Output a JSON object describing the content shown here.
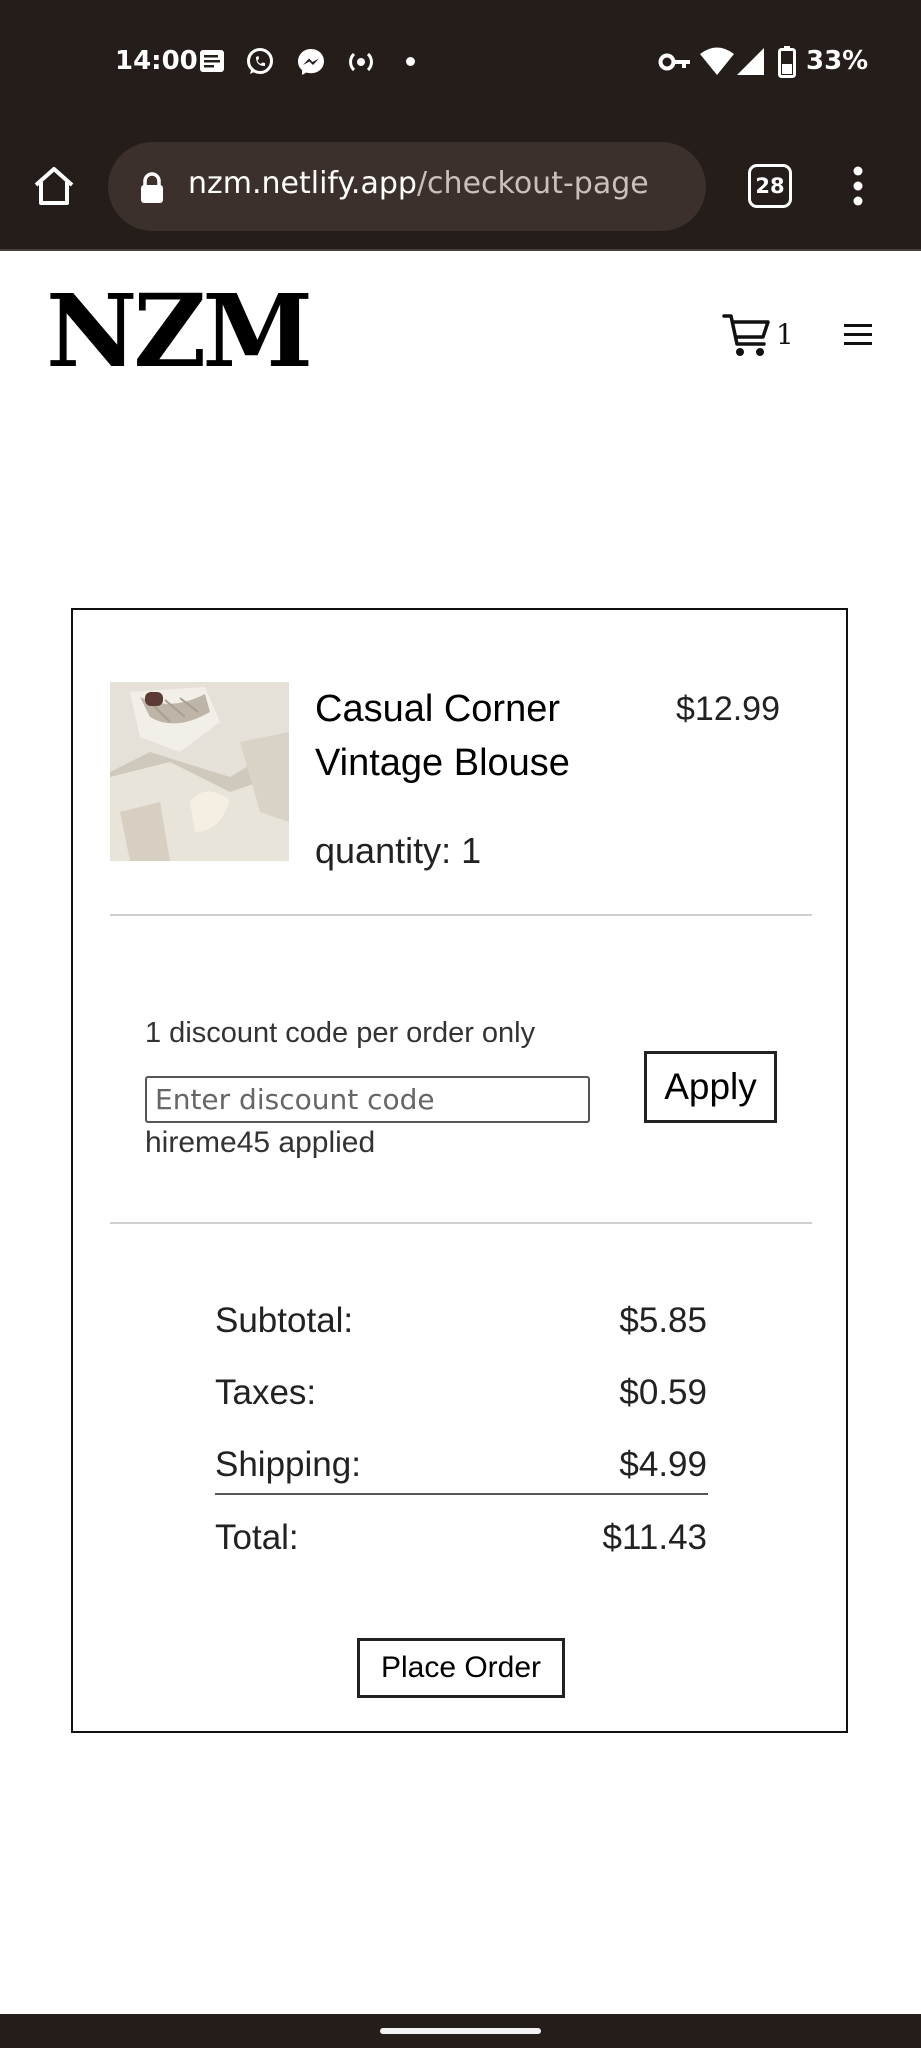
{
  "status_bar": {
    "time": "14:00",
    "battery": "33%",
    "icons": [
      "notes-icon",
      "whatsapp-icon",
      "messenger-icon",
      "hotspot-icon",
      "dot-icon",
      "vpn-key-icon",
      "wifi-icon",
      "signal-icon",
      "battery-icon"
    ]
  },
  "browser": {
    "url_domain": "nzm.netlify.app",
    "url_path": "/checkout-page",
    "tab_count": "28",
    "icons": [
      "home-icon",
      "lock-icon",
      "more-vert-icon"
    ]
  },
  "site": {
    "logo": "NZM",
    "cart_count": "1",
    "icons": [
      "cart-icon",
      "menu-icon"
    ]
  },
  "cart_item": {
    "name": "Casual Corner Vintage Blouse",
    "price": "$12.99",
    "quantity": "quantity: 1"
  },
  "discount": {
    "note": "1 discount code per order only",
    "placeholder": "Enter discount code",
    "status": "hireme45 applied",
    "apply_label": "Apply"
  },
  "summary": {
    "subtotal_label": "Subtotal:",
    "subtotal_value": "$5.85",
    "taxes_label": "Taxes:",
    "taxes_value": "$0.59",
    "shipping_label": "Shipping:",
    "shipping_value": "$4.99",
    "total_label": "Total:",
    "total_value": "$11.43"
  },
  "place_order_label": "Place Order",
  "colors": {
    "chrome": "#241d1a",
    "url_pill": "#3b302b",
    "text": "#111111",
    "background": "#ffffff"
  }
}
